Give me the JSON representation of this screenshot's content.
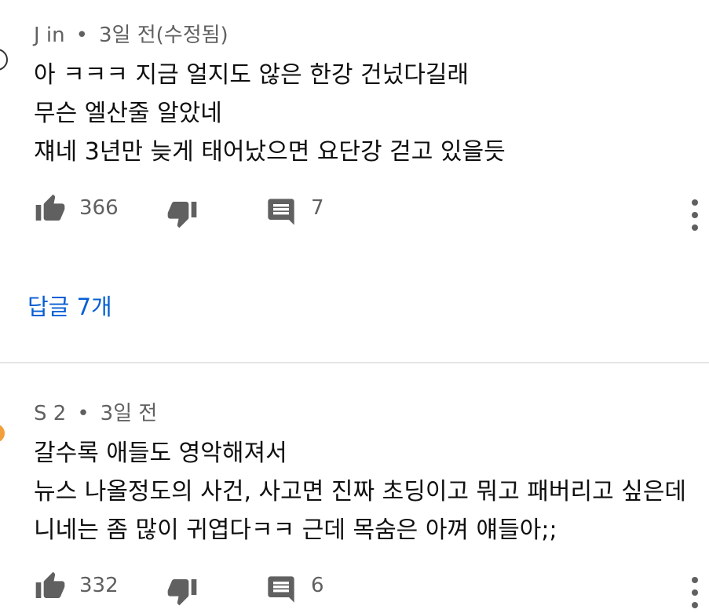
{
  "colors": {
    "text": "#0f0f0f",
    "meta": "#606060",
    "link": "#065fd4",
    "icon": "#606060",
    "divider": "#e5e5e5",
    "avatar2": "#f29f3b"
  },
  "comments": [
    {
      "author": "J in",
      "time": "3일 전(수정됨)",
      "lines": [
        "아 ㅋㅋㅋ 지금 얼지도 않은 한강 건넜다길래",
        "무슨 엘산줄 알았네",
        "쟤네 3년만 늦게 태어났으면 요단강 걷고 있을듯"
      ],
      "likes": "366",
      "replies_count": "7",
      "replies_link": "답글 7개",
      "icons": {
        "like": "thumbs-up-icon",
        "dislike": "thumbs-down-icon",
        "reply": "comment-icon",
        "more": "more-vert-icon"
      }
    },
    {
      "author": "S 2",
      "time": "3일 전",
      "lines": [
        "갈수록 애들도 영악해져서",
        "뉴스 나올정도의 사건, 사고면 진짜 초딩이고 뭐고 패버리고 싶은데",
        "니네는 좀 많이 귀엽다ㅋㅋ 근데 목숨은 아껴 얘들아;;"
      ],
      "likes": "332",
      "replies_count": "6",
      "icons": {
        "like": "thumbs-up-icon",
        "dislike": "thumbs-down-icon",
        "reply": "comment-icon",
        "more": "more-vert-icon"
      }
    }
  ]
}
